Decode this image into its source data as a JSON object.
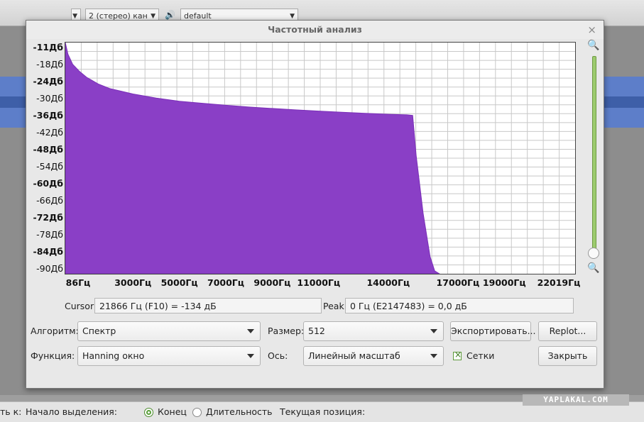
{
  "background": {
    "toolbar": {
      "channels_select": "2 (стерео) кан",
      "device_select": "default"
    },
    "statusbar": {
      "label_prefix": "ть к:",
      "selection_start": "Начало выделения:",
      "radio_end": "Конец",
      "radio_length": "Длительность",
      "current_position": "Текущая позиция:"
    },
    "watermark": "YAPLAKAL.COM"
  },
  "dialog": {
    "title": "Частотный анализ",
    "cursor_label": "Cursor:",
    "cursor_value": "21866 Гц (F10) = -134 дБ",
    "peak_label": "Peak:",
    "peak_value": "0 Гц (E2147483) = 0,0 дБ",
    "algorithm_label": "Алгоритм:",
    "algorithm_value": "Спектр",
    "size_label": "Размер:",
    "size_value": "512",
    "export_button": "Экспортировать...",
    "replot_button": "Replot...",
    "function_label": "Функция:",
    "function_value": "Hanning окно",
    "axis_label": "Ось:",
    "axis_value": "Линейный масштаб",
    "grid_label": "Сетки",
    "grid_checked": true,
    "close_button": "Закрыть"
  },
  "chart_data": {
    "type": "area",
    "y_tick_labels": [
      "-11Дб",
      "-18Дб",
      "-24Дб",
      "-30Дб",
      "-36Дб",
      "-42Дб",
      "-48Дб",
      "-54Дб",
      "-60Дб",
      "-66Дб",
      "-72Дб",
      "-78Дб",
      "-84Дб",
      "-90Дб"
    ],
    "x_tick_labels": [
      "86Гц",
      "3000Гц",
      "5000Гц",
      "7000Гц",
      "9000Гц",
      "11000Гц",
      "14000Гц",
      "17000Гц",
      "19000Гц",
      "22019Гц"
    ],
    "x_tick_values": [
      86,
      3000,
      5000,
      7000,
      9000,
      11000,
      14000,
      17000,
      19000,
      22019
    ],
    "xlim": [
      86,
      22050
    ],
    "ylim": [
      -91,
      -11
    ],
    "grid": true,
    "color": "#8a3fc6",
    "series": [
      {
        "x": [
          86,
          200,
          400,
          700,
          1000,
          1500,
          2000,
          3000,
          4000,
          5000,
          6000,
          7000,
          8000,
          9000,
          10000,
          11000,
          12000,
          13000,
          14000,
          14800,
          15050,
          15200,
          15500,
          15800,
          16000,
          16200
        ],
        "y": [
          -11,
          -15,
          -18.5,
          -21,
          -23,
          -25.3,
          -26.9,
          -28.8,
          -30.2,
          -31.3,
          -32.0,
          -32.7,
          -33.3,
          -33.8,
          -34.3,
          -34.7,
          -35.1,
          -35.5,
          -35.8,
          -36.0,
          -36.2,
          -50,
          -70,
          -85,
          -90,
          -91
        ]
      }
    ]
  }
}
